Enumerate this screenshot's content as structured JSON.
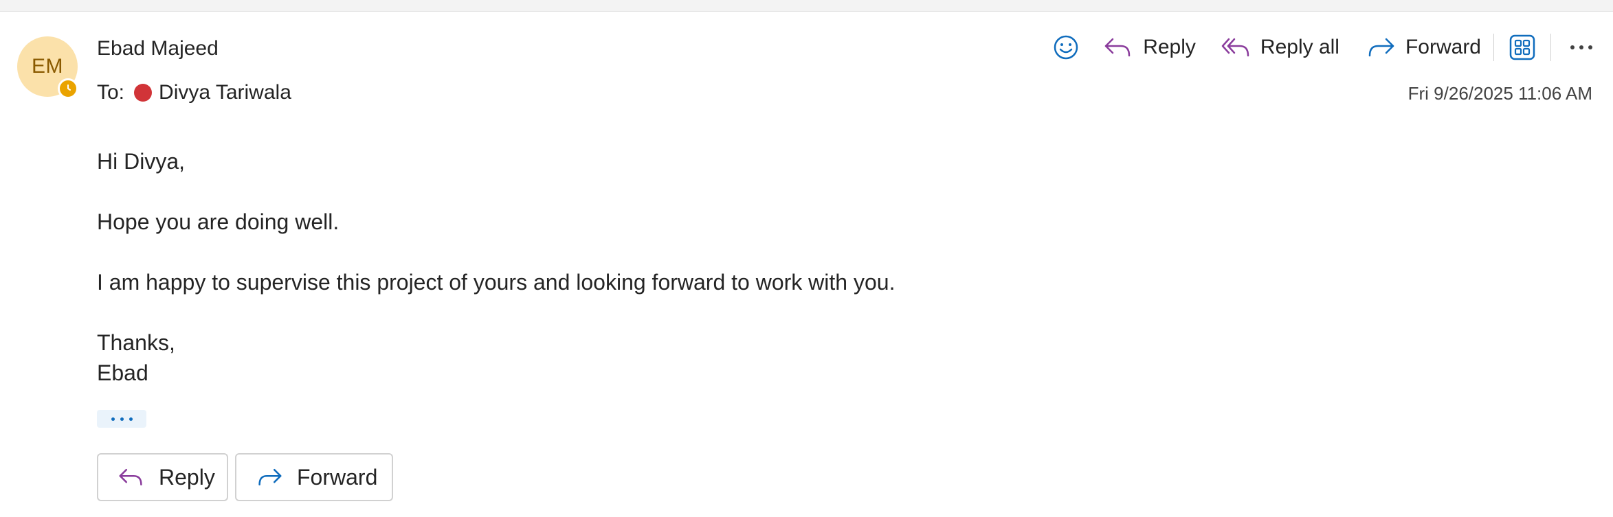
{
  "message": {
    "avatar_initials": "EM",
    "sender_name": "Ebad Majeed",
    "to_label": "To:",
    "recipient_name": "Divya Tariwala",
    "timestamp": "Fri 9/26/2025 11:06 AM"
  },
  "toolbar": {
    "reply_label": "Reply",
    "reply_all_label": "Reply all",
    "forward_label": "Forward"
  },
  "body": {
    "greeting": "Hi Divya,",
    "line1": "Hope you are doing well.",
    "line2": "I am happy to supervise this project of yours and looking forward to work with you.",
    "signoff": "Thanks,",
    "signature": "Ebad"
  },
  "footer": {
    "reply_label": "Reply",
    "forward_label": "Forward"
  },
  "colors": {
    "reply_icon": "#8a3c9c",
    "forward_icon": "#0f6cbd",
    "avatar_bg": "#fbe1aa",
    "presence": "#eaa300",
    "recipient_dot": "#d13438"
  },
  "icons": [
    "emoji-icon",
    "reply-icon",
    "reply-all-icon",
    "forward-icon",
    "apps-icon",
    "more-icon",
    "clock-icon"
  ]
}
